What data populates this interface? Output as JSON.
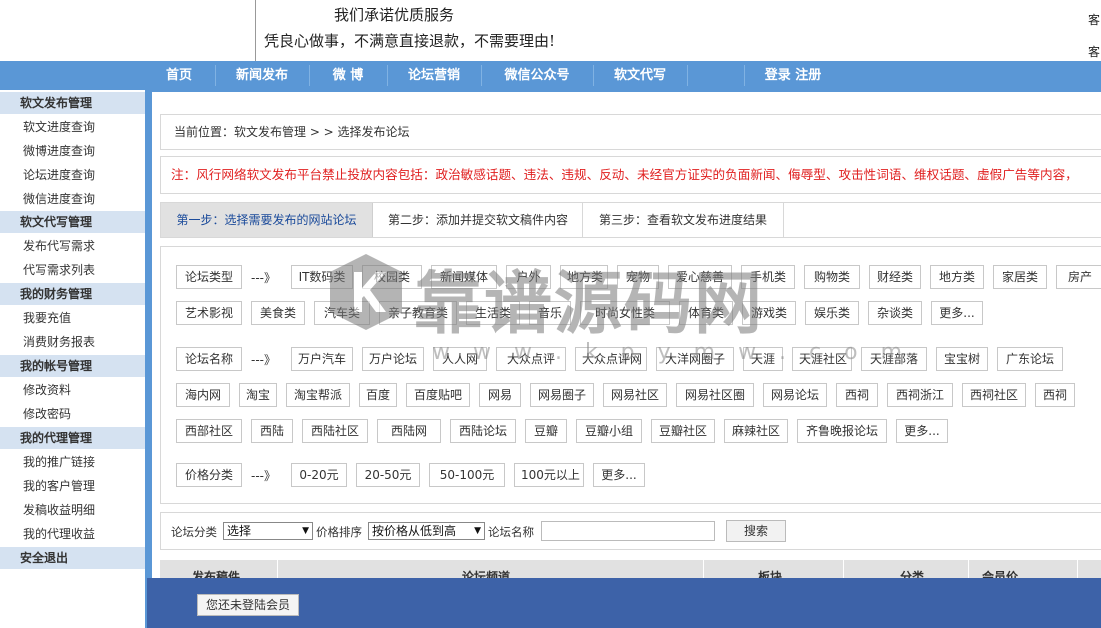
{
  "header": {
    "slogan_1": "我们承诺优质服务",
    "slogan_2": "凭良心做事，不满意直接退款，不需要理由!",
    "edge_1": "客",
    "edge_2": "客"
  },
  "nav": {
    "items": [
      "首页",
      "新闻发布",
      "微 博",
      "论坛营销",
      "微信公众号",
      "软文代写",
      "",
      "登录 注册"
    ]
  },
  "sidebar": {
    "groups": [
      {
        "title": "软文发布管理",
        "items": [
          "软文进度查询",
          "微博进度查询",
          "论坛进度查询",
          "微信进度查询"
        ]
      },
      {
        "title": "软文代写管理",
        "items": [
          "发布代写需求",
          "代写需求列表"
        ]
      },
      {
        "title": "我的财务管理",
        "items": [
          "我要充值",
          "消费财务报表"
        ]
      },
      {
        "title": "我的帐号管理",
        "items": [
          "修改资料",
          "修改密码"
        ]
      },
      {
        "title": "我的代理管理",
        "items": [
          "我的推广链接",
          "我的客户管理",
          "发稿收益明细",
          "我的代理收益"
        ]
      },
      {
        "title": "安全退出",
        "items": []
      }
    ]
  },
  "breadcrumb": "当前位置：软文发布管理 > > 选择发布论坛",
  "notice": "注：风行网络软文发布平台禁止投放内容包括：政治敏感话题、违法、违规、反动、未经官方证实的负面新闻、侮辱型、攻击性词语、维权话题、虚假广告等内容，",
  "steps": [
    "第一步：选择需要发布的网站论坛",
    "第二步：添加并提交软文稿件内容",
    "第三步：查看软文发布进度结果"
  ],
  "filters": {
    "arrow": "---》",
    "type_label": "论坛类型",
    "type_row1": [
      "IT数码类",
      "校园类",
      "新闻媒体",
      "户外",
      "地方类",
      "宠物",
      "爱心慈善",
      "手机类",
      "购物类",
      "财经类",
      "地方类",
      "家居类",
      "房产"
    ],
    "type_row2": [
      "艺术影视",
      "美食类",
      "汽车类",
      "亲子教育类",
      "生活类",
      "音乐",
      "时尚女性类",
      "体育类",
      "游戏类",
      "娱乐类",
      "杂谈类",
      "更多..."
    ],
    "name_label": "论坛名称",
    "name_row1": [
      "万户汽车",
      "万户论坛",
      "人人网",
      "大众点评",
      "大众点评网",
      "大洋网圈子",
      "天涯",
      "天涯社区",
      "天涯部落",
      "宝宝树",
      "广东论坛"
    ],
    "name_row2": [
      "海内网",
      "淘宝",
      "淘宝帮派",
      "百度",
      "百度贴吧",
      "网易",
      "网易圈子",
      "网易社区",
      "网易社区圈",
      "网易论坛",
      "西祠",
      "西祠浙江",
      "西祠社区",
      "西祠"
    ],
    "name_row3": [
      "西部社区",
      "西陆",
      "西陆社区",
      "西陆网",
      "西陆论坛",
      "豆瓣",
      "豆瓣小组",
      "豆瓣社区",
      "麻辣社区",
      "齐鲁晚报论坛",
      "更多..."
    ],
    "price_label": "价格分类",
    "price_row": [
      "0-20元",
      "20-50元",
      "50-100元",
      "100元以上",
      "更多..."
    ]
  },
  "search": {
    "category_label": "论坛分类",
    "category_value": "选择",
    "sort_label": "价格排序",
    "sort_value": "按价格从低到高",
    "name_label": "论坛名称",
    "name_value": "",
    "button": "搜索"
  },
  "table": {
    "headers": [
      "发布稿件",
      "论坛频道",
      "板块",
      "分类",
      "会员价"
    ]
  },
  "login_notice": "您还未登陆会员",
  "watermark": {
    "text": "靠谱源码网",
    "url": "w w w . k p y m w . c o m"
  }
}
